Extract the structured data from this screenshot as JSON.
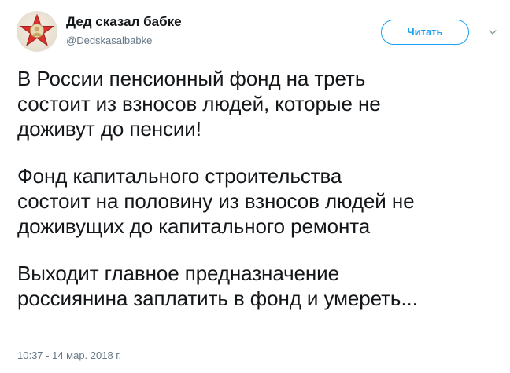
{
  "author": {
    "display_name": "Дед сказал бабке",
    "handle": "@Dedskasalbabke",
    "avatar_icon": "red-star-medal-icon"
  },
  "actions": {
    "follow_label": "Читать",
    "menu_icon": "chevron-down-icon"
  },
  "tweet": {
    "paragraphs": [
      "В России пенсионный фонд на треть\nсостоит из взносов людей, которые не\nдоживут до пенсии!",
      "Фонд капитального строительства\nсостоит на половину из взносов людей не\nдоживущих до капитального ремонта",
      "Выходит главное предназначение\nроссиянина заплатить в фонд и умереть..."
    ],
    "timestamp": "10:37 - 14 мар. 2018 г."
  },
  "colors": {
    "accent": "#1da1f2",
    "text": "#14171a",
    "secondary_text": "#657786"
  }
}
